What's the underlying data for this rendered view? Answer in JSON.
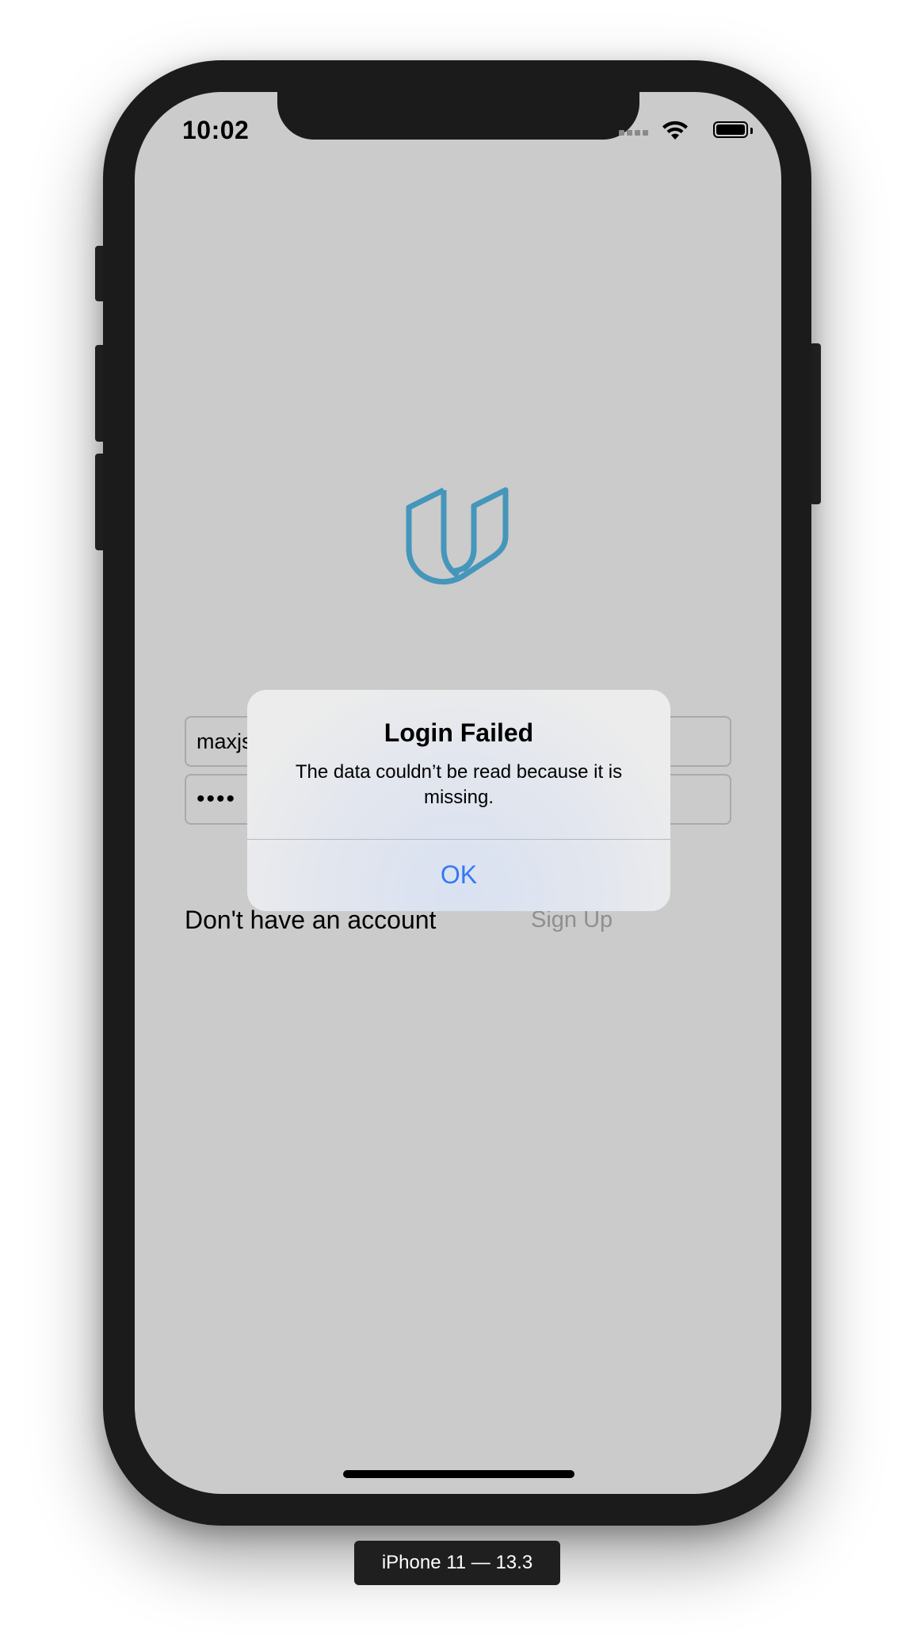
{
  "status_bar": {
    "time": "10:02"
  },
  "login": {
    "email_value": "maxjs",
    "password_value": "••••",
    "no_account_label": "Don't have an account",
    "signup_label": "Sign Up"
  },
  "alert": {
    "title": "Login Failed",
    "message": "The data couldn’t be read because it is missing.",
    "ok_label": "OK"
  },
  "device_label": "iPhone 11 — 13.3",
  "colors": {
    "screen_background": "#cbcbcb",
    "logo": "#4596bb",
    "alert_button": "#3478f6",
    "signup_text": "#8f8f8f"
  },
  "icons": {
    "logo": "udacity-logo-icon",
    "wifi": "wifi-icon",
    "battery": "battery-icon",
    "signal": "cellular-signal-icon"
  }
}
